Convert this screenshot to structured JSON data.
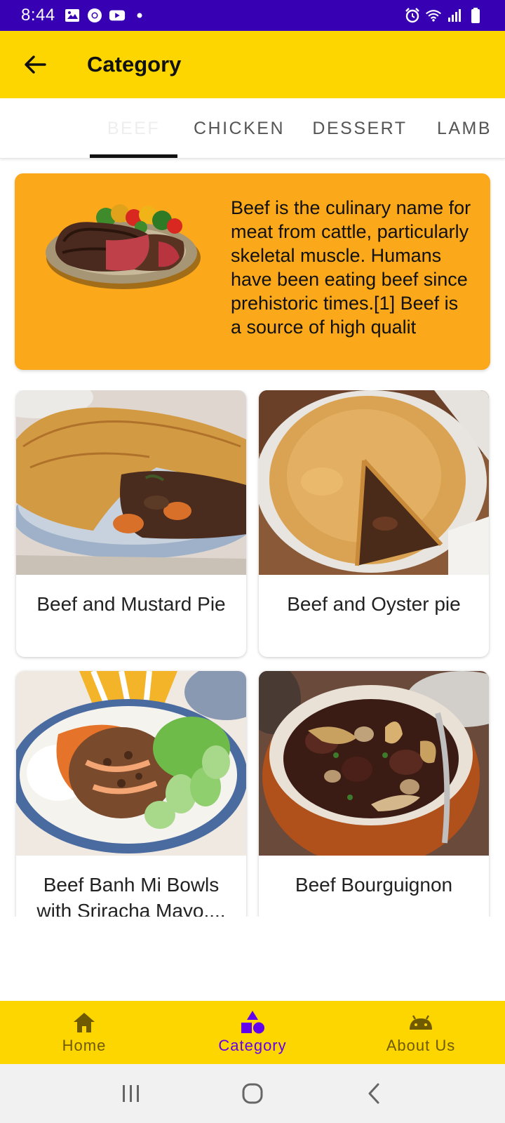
{
  "status_bar": {
    "time": "8:44",
    "left_icons": [
      "gallery-icon",
      "chrome-icon",
      "youtube-icon",
      "dot-icon"
    ],
    "right_icons": [
      "alarm-icon",
      "wifi-icon",
      "signal-icon",
      "battery-icon"
    ]
  },
  "app_bar": {
    "title": "Category",
    "back_icon": "arrow-back-icon"
  },
  "tabs": [
    {
      "label": "BEEF",
      "selected": true
    },
    {
      "label": "CHICKEN",
      "selected": false
    },
    {
      "label": "DESSERT",
      "selected": false
    },
    {
      "label": "LAMB",
      "selected": false
    }
  ],
  "category_description": {
    "image": "steak-with-vegetables",
    "text": "Beef is the culinary name for meat from cattle, particularly skeletal muscle. Humans have been eating beef since prehistoric times.[1] Beef is a source of high qualit"
  },
  "meals": [
    {
      "name": "Beef and Mustard Pie",
      "image": "pie-with-carrots"
    },
    {
      "name": "Beef and Oyster pie",
      "image": "pie-in-dish"
    },
    {
      "name": "Beef Banh Mi Bowls with Sriracha Mayo,...",
      "image": "rice-bowl"
    },
    {
      "name": "Beef Bourguignon",
      "image": "stew-pot"
    }
  ],
  "bottom_nav": [
    {
      "label": "Home",
      "icon": "home-icon",
      "selected": false
    },
    {
      "label": "Category",
      "icon": "shapes-icon",
      "selected": true
    },
    {
      "label": "About Us",
      "icon": "android-icon",
      "selected": false
    }
  ],
  "system_nav": [
    "recents-icon",
    "home-circle-icon",
    "back-chevron-icon"
  ],
  "colors": {
    "status_bar": "#3700b3",
    "app_bar": "#fdd600",
    "description_card": "#fba81a",
    "nav_selected": "#6200ee",
    "nav_unselected": "#6f5a00"
  }
}
